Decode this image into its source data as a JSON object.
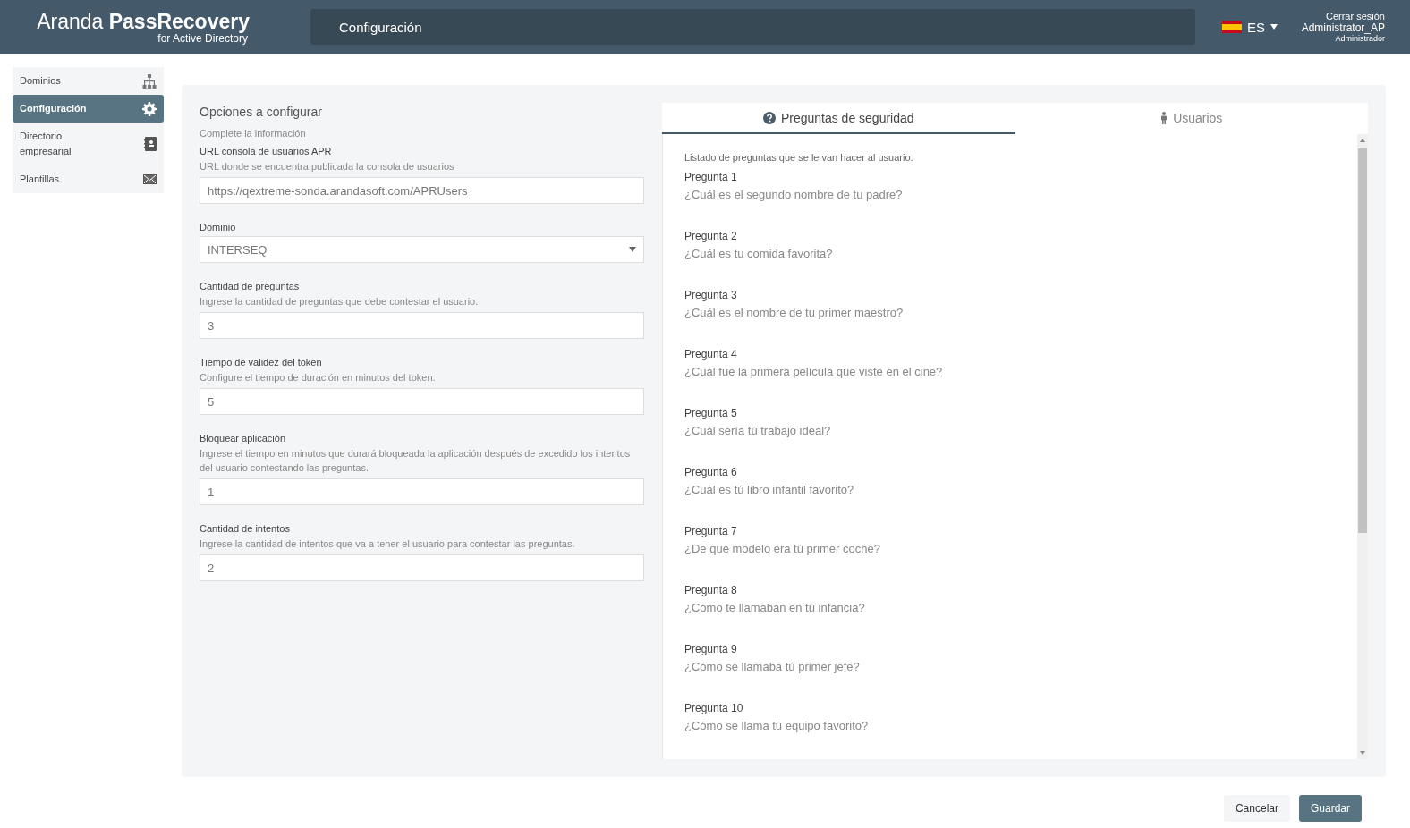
{
  "header": {
    "brand": "Aranda",
    "brand_bold": "PassRecovery",
    "brand_sub": "for Active Directory",
    "page_title": "Configuración",
    "language": "ES",
    "logout": "Cerrar sesión",
    "user": "Administrator_AP",
    "role": "Administrador"
  },
  "sidebar": {
    "items": [
      {
        "label": "Dominios",
        "kind": "hierarchy",
        "selected": false
      },
      {
        "label": "Configuración",
        "kind": "gear",
        "selected": true
      },
      {
        "label": "Directorio empresarial",
        "kind": "contacts",
        "selected": false
      },
      {
        "label": "Plantillas",
        "kind": "mail",
        "selected": false
      }
    ]
  },
  "form": {
    "title": "Opciones a configurar",
    "subtitle": "Complete la información",
    "fields": [
      {
        "kind": "text",
        "label": "URL consola de usuarios APR",
        "help": "URL donde se encuentra publicada la consola de usuarios",
        "value": "https://qextreme-sonda.arandasoft.com/APRUsers"
      },
      {
        "kind": "select",
        "label": "Dominio",
        "value": "INTERSEQ"
      },
      {
        "kind": "text",
        "label": "Cantidad de preguntas",
        "help": "Ingrese la cantidad de preguntas que debe contestar el usuario.",
        "value": "3"
      },
      {
        "kind": "text",
        "label": "Tiempo de validez del token",
        "help": "Configure el tiempo de duración en minutos del token.",
        "value": "5"
      },
      {
        "kind": "text",
        "label": "Bloquear aplicación",
        "help": "Ingrese el tiempo en minutos que durará bloqueada la aplicación después de excedido los intentos del usuario contestando las preguntas.",
        "value": "1"
      },
      {
        "kind": "text",
        "label": "Cantidad de intentos",
        "help": "Ingrese la cantidad de intentos que va a tener el usuario para contestar las preguntas.",
        "value": "2"
      }
    ]
  },
  "tabs": [
    {
      "label": "Preguntas de seguridad",
      "kind": "question",
      "selected": true
    },
    {
      "label": "Usuarios",
      "kind": "person",
      "selected": false
    }
  ],
  "questions": {
    "intro": "Listado de preguntas que se le van hacer al usuario.",
    "items": [
      {
        "label": "Pregunta 1",
        "text": "¿Cuál es el segundo nombre de tu padre?"
      },
      {
        "label": "Pregunta 2",
        "text": "¿Cuál es tu comida favorita?"
      },
      {
        "label": "Pregunta 3",
        "text": "¿Cuál es el nombre de tu primer maestro?"
      },
      {
        "label": "Pregunta 4",
        "text": "¿Cuál fue la primera película que viste en el cine?"
      },
      {
        "label": "Pregunta 5",
        "text": "¿Cuál sería tú trabajo ideal?"
      },
      {
        "label": "Pregunta 6",
        "text": "¿Cuál es tú libro infantil favorito?"
      },
      {
        "label": "Pregunta 7",
        "text": "¿De qué modelo era tú primer coche?"
      },
      {
        "label": "Pregunta 8",
        "text": "¿Cómo te llamaban en tú infancia?"
      },
      {
        "label": "Pregunta 9",
        "text": "¿Cómo se llamaba tú primer jefe?"
      },
      {
        "label": "Pregunta 10",
        "text": "¿Cómo se llama tú equipo favorito?"
      }
    ]
  },
  "buttons": [
    {
      "label": "Cancelar",
      "kind": "secondary"
    },
    {
      "label": "Guardar",
      "kind": "primary"
    }
  ]
}
